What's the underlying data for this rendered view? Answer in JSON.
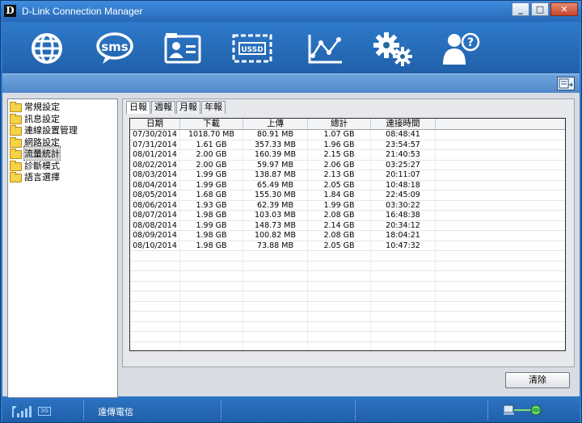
{
  "window": {
    "title": "D-Link Connection Manager",
    "logo_letter": "D",
    "minimize": "_",
    "maximize": "□",
    "close": "✕"
  },
  "toolbar": {
    "items": [
      {
        "name": "internet",
        "icon": "globe-icon"
      },
      {
        "name": "sms",
        "icon": "sms-bubble-icon",
        "label": "sms"
      },
      {
        "name": "contacts",
        "icon": "contact-card-icon"
      },
      {
        "name": "ussd",
        "icon": "ussd-card-icon",
        "label": "USSD"
      },
      {
        "name": "statistics",
        "icon": "line-chart-icon"
      },
      {
        "name": "settings",
        "icon": "gears-icon"
      },
      {
        "name": "help",
        "icon": "user-help-icon",
        "label": "?"
      }
    ]
  },
  "sidebar": {
    "items": [
      {
        "label": "常規設定",
        "selected": false
      },
      {
        "label": "訊息設定",
        "selected": false
      },
      {
        "label": "連線設置管理",
        "selected": false
      },
      {
        "label": "網路設定",
        "selected": false
      },
      {
        "label": "流量統計",
        "selected": true
      },
      {
        "label": "診斷模式",
        "selected": false
      },
      {
        "label": "語言選擇",
        "selected": false
      }
    ]
  },
  "tabs": [
    "日報",
    "週報",
    "月報",
    "年報"
  ],
  "active_tab": "日報",
  "table": {
    "columns": [
      "日期",
      "下載",
      "上傳",
      "總計",
      "連接時間"
    ],
    "rows": [
      [
        "07/30/2014",
        "1018.70 MB",
        "80.91 MB",
        "1.07 GB",
        "08:48:41"
      ],
      [
        "07/31/2014",
        "1.61 GB",
        "357.33 MB",
        "1.96 GB",
        "23:54:57"
      ],
      [
        "08/01/2014",
        "2.00 GB",
        "160.39 MB",
        "2.15 GB",
        "21:40:53"
      ],
      [
        "08/02/2014",
        "2.00 GB",
        "59.97 MB",
        "2.06 GB",
        "03:25:27"
      ],
      [
        "08/03/2014",
        "1.99 GB",
        "138.87 MB",
        "2.13 GB",
        "20:11:07"
      ],
      [
        "08/04/2014",
        "1.99 GB",
        "65.49 MB",
        "2.05 GB",
        "10:48:18"
      ],
      [
        "08/05/2014",
        "1.68 GB",
        "155.30 MB",
        "1.84 GB",
        "22:45:09"
      ],
      [
        "08/06/2014",
        "1.93 GB",
        "62.39 MB",
        "1.99 GB",
        "03:30:22"
      ],
      [
        "08/07/2014",
        "1.98 GB",
        "103.03 MB",
        "2.08 GB",
        "16:48:38"
      ],
      [
        "08/08/2014",
        "1.99 GB",
        "148.73 MB",
        "2.14 GB",
        "20:34:12"
      ],
      [
        "08/09/2014",
        "1.98 GB",
        "100.82 MB",
        "2.08 GB",
        "18:04:21"
      ],
      [
        "08/10/2014",
        "1.98 GB",
        "73.88 MB",
        "2.05 GB",
        "10:47:32"
      ]
    ],
    "empty_rows": 10
  },
  "buttons": {
    "clear": "清除"
  },
  "status": {
    "network_type": "3G",
    "carrier": "遠傳電信",
    "signal_icon": "signal-bars-icon",
    "connection_icon": "connection-status-icon"
  },
  "colors": {
    "accent": "#2f79c9",
    "toolbar": "#1f5fa8",
    "strip": "#5b93d1",
    "panel": "#d9dde3"
  }
}
